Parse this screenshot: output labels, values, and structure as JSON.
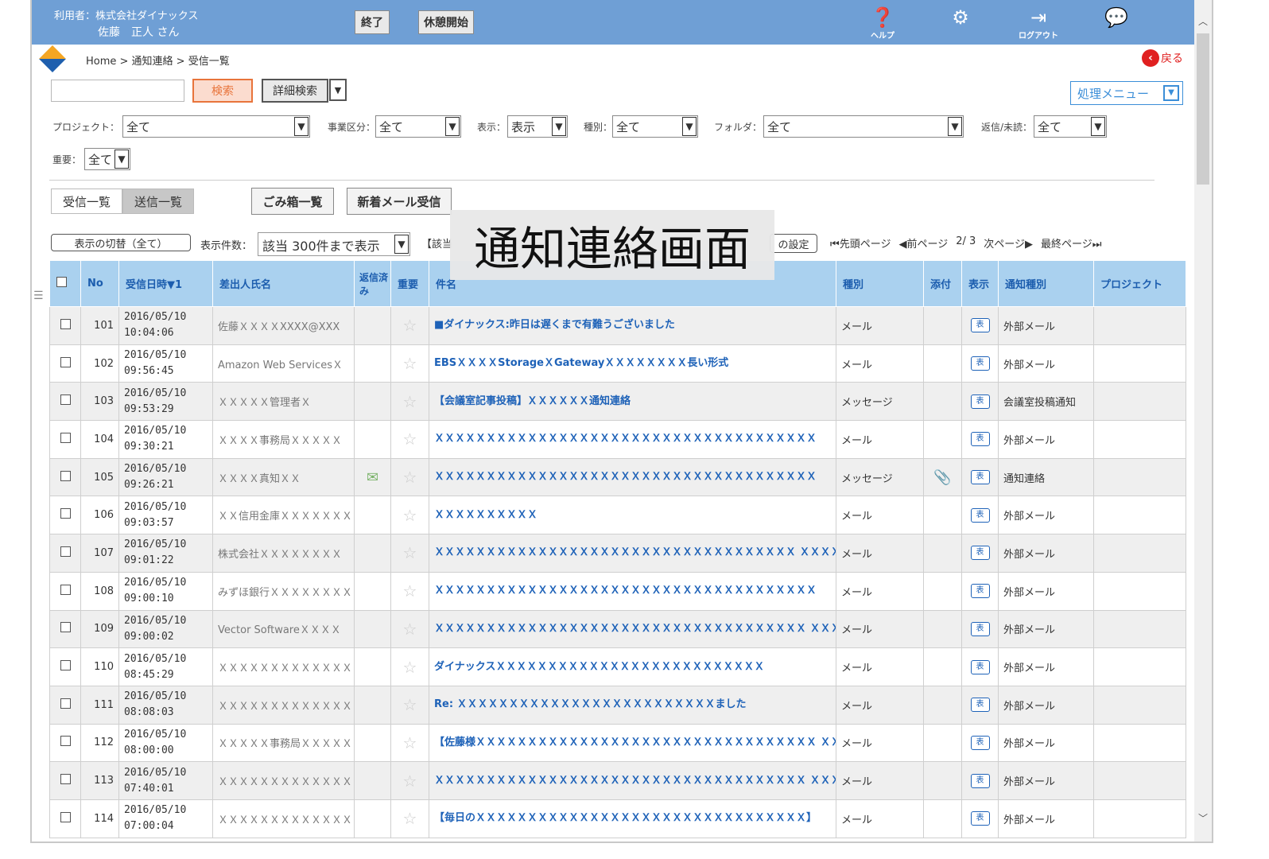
{
  "header": {
    "user_label": "利用者：株式会社ダイナックス",
    "user_name": "佐藤　正人 さん",
    "end_label": "終了",
    "break_label": "休憩開始",
    "help_label": "ヘルプ",
    "logout_label": "ログアウト"
  },
  "breadcrumb": {
    "text": "Home > 通知連絡 > 受信一覧",
    "back_label": "戻る"
  },
  "search": {
    "value": "",
    "search_label": "検索",
    "detail_label": "詳細検索",
    "process_menu_label": "処理メニュー"
  },
  "filters": {
    "project": {
      "label": "プロジェクト：",
      "value": "全て"
    },
    "business": {
      "label": "事業区分：",
      "value": "全て"
    },
    "display": {
      "label": "表示：",
      "value": "表示"
    },
    "kind": {
      "label": "種別：",
      "value": "全て"
    },
    "folder": {
      "label": "フォルダ：",
      "value": "全て"
    },
    "reply": {
      "label": "返信/未読：",
      "value": "全て"
    },
    "important": {
      "label": "重要：",
      "value": "全て"
    }
  },
  "tabs": {
    "inbox": "受信一覧",
    "sent": "送信一覧",
    "trash": "ごみ箱一覧",
    "new_mail": "新着メール受信"
  },
  "list_controls": {
    "toggle_label": "表示の切替（全て）",
    "count_label": "表示件数：",
    "count_value": "該当 300件まで表示",
    "bracket_text": "【該当",
    "settings_label": "の設定",
    "first_page": "先頭ページ",
    "prev_page": "前ページ",
    "page_info": "2/ 3",
    "next_page": "次ページ",
    "last_page": "最終ページ"
  },
  "overlay_caption": "通知連絡画面",
  "columns": {
    "no": "No",
    "received": "受信日時▼1",
    "sender": "差出人氏名",
    "replied": "返信済み",
    "important": "重要",
    "subject": "件名",
    "kind": "種別",
    "attach": "添付",
    "display": "表示",
    "notify_kind": "通知種別",
    "project": "プロジェクト"
  },
  "rows": [
    {
      "no": "101",
      "date": "2016/05/10",
      "time": "10:04:06",
      "sender": "佐藤ＸＸＸＸXXXX@XXX",
      "replied": false,
      "subject": "■ダイナックス:昨日は遅くまで有難うございました",
      "kind": "メール",
      "attach": false,
      "disp": "表",
      "notify": "外部メール"
    },
    {
      "no": "102",
      "date": "2016/05/10",
      "time": "09:56:45",
      "sender": "Amazon Web ServicesＸ",
      "replied": false,
      "subject": "EBSＸＸＸＸStorageＸGatewayＸＸＸＸＸＸＸＸ長い形式",
      "kind": "メール",
      "attach": false,
      "disp": "表",
      "notify": "外部メール"
    },
    {
      "no": "103",
      "date": "2016/05/10",
      "time": "09:53:29",
      "sender": "ＸＸＸＸＸ管理者Ｘ",
      "replied": false,
      "subject": "【会議室記事投稿】ＸＸＸＸＸＸ通知連絡",
      "kind": "メッセージ",
      "attach": false,
      "disp": "表",
      "notify": "会議室投稿通知"
    },
    {
      "no": "104",
      "date": "2016/05/10",
      "time": "09:30:21",
      "sender": "ＸＸＸＸ事務局ＸＸＸＸＸ",
      "replied": false,
      "subject": "ＸＸＸＸＸＸＸＸＸＸＸＸＸＸＸＸＸＸＸＸＸＸＸＸＸＸＸＸＸＸＸＸＸＸＸＸＸ",
      "kind": "メール",
      "attach": false,
      "disp": "表",
      "notify": "外部メール"
    },
    {
      "no": "105",
      "date": "2016/05/10",
      "time": "09:26:21",
      "sender": "ＸＸＸＸ真知ＸＸ",
      "replied": true,
      "subject": "ＸＸＸＸＸＸＸＸＸＸＸＸＸＸＸＸＸＸＸＸＸＸＸＸＸＸＸＸＸＸＸＸＸＸＸＸＸ",
      "kind": "メッセージ",
      "attach": true,
      "disp": "表",
      "notify": "通知連絡"
    },
    {
      "no": "106",
      "date": "2016/05/10",
      "time": "09:03:57",
      "sender": "ＸＸ信用金庫ＸＸＸＸＸＸＸ",
      "replied": false,
      "subject": "ＸＸＸＸＸＸＸＸＸＸ",
      "kind": "メール",
      "attach": false,
      "disp": "表",
      "notify": "外部メール"
    },
    {
      "no": "107",
      "date": "2016/05/10",
      "time": "09:01:22",
      "sender": "株式会社ＸＸＸＸＸＸＸＸ",
      "replied": false,
      "subject": "ＸＸＸＸＸＸＸＸＸＸＸＸＸＸＸＸＸＸＸＸＸＸＸＸＸＸＸＸＸＸＸＸＸＸＸ ＸＸＸＸＸＸＸＸＸＸＸＸＸＸＸＸＸＸＸＸＸＸＸ★☆★",
      "kind": "メール",
      "attach": false,
      "disp": "表",
      "notify": "外部メール"
    },
    {
      "no": "108",
      "date": "2016/05/10",
      "time": "09:00:10",
      "sender": "みずほ銀行ＸＸＸＸＸＸＸＸ",
      "replied": false,
      "subject": "ＸＸＸＸＸＸＸＸＸＸＸＸＸＸＸＸＸＸＸＸＸＸＸＸＸＸＸＸＸＸＸＸＸＸＸＸＸ",
      "kind": "メール",
      "attach": false,
      "disp": "表",
      "notify": "外部メール"
    },
    {
      "no": "109",
      "date": "2016/05/10",
      "time": "09:00:02",
      "sender": "Vector SoftwareＸＸＸＸ",
      "replied": false,
      "subject": "ＸＸＸＸＸＸＸＸＸＸＸＸＸＸＸＸＸＸＸＸＸＸＸＸＸＸＸＸＸＸＸＸＸＸＸＸ ＸＸＸＸＸＸＸＸＸＸＸＸＸＸＸＸＸ",
      "kind": "メール",
      "attach": false,
      "disp": "表",
      "notify": "外部メール"
    },
    {
      "no": "110",
      "date": "2016/05/10",
      "time": "08:45:29",
      "sender": "ＸＸＸＸＸＸＸＸＸＸＸＸＸＸ",
      "replied": false,
      "subject": "ダイナックスＸＸＸＸＸＸＸＸＸＸＸＸＸＸＸＸＸＸＸＸＸＸＸＸＸＸ",
      "kind": "メール",
      "attach": false,
      "disp": "表",
      "notify": "外部メール"
    },
    {
      "no": "111",
      "date": "2016/05/10",
      "time": "08:08:03",
      "sender": "ＸＸＸＸＸＸＸＸＸＸＸＸＸＸ",
      "replied": false,
      "subject": "Re: ＸＸＸＸＸＸＸＸＸＸＸＸＸＸＸＸＸＸＸＸＸＸＸＸＸました",
      "kind": "メール",
      "attach": false,
      "disp": "表",
      "notify": "外部メール"
    },
    {
      "no": "112",
      "date": "2016/05/10",
      "time": "08:00:00",
      "sender": "ＸＸＸＸＸ事務局ＸＸＸＸＸ",
      "replied": false,
      "subject": "【佐藤様ＸＸＸＸＸＸＸＸＸＸＸＸＸＸＸＸＸＸＸＸＸＸＸＸＸＸＸＸＸＸＸＸＸ ＸＸＸＸＸＸ】",
      "kind": "メール",
      "attach": false,
      "disp": "表",
      "notify": "外部メール"
    },
    {
      "no": "113",
      "date": "2016/05/10",
      "time": "07:40:01",
      "sender": "ＸＸＸＸＸＸＸＸＸＸＸＸＸＸ",
      "replied": false,
      "subject": "ＸＸＸＸＸＸＸＸＸＸＸＸＸＸＸＸＸＸＸＸＸＸＸＸＸＸＸＸＸＸＸＸＸＸＸＸ ＸＸＸＸＸＸＸＸＸＸＸＸＸＸＸＸＸＸＸＸＸＸＸＸＸ",
      "kind": "メール",
      "attach": false,
      "disp": "表",
      "notify": "外部メール"
    },
    {
      "no": "114",
      "date": "2016/05/10",
      "time": "07:00:04",
      "sender": "ＸＸＸＸＸＸＸＸＸＸＸＸＸＸ",
      "replied": false,
      "subject": "【毎日のＸＸＸＸＸＸＸＸＸＸＸＸＸＸＸＸＸＸＸＸＸＸＸＸＸＸＸＸＸＸＸＸ】",
      "kind": "メール",
      "attach": false,
      "disp": "表",
      "notify": "外部メール"
    }
  ]
}
